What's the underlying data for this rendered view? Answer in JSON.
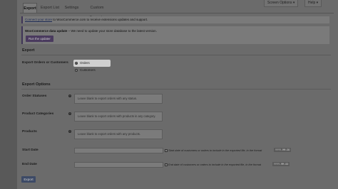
{
  "header": {
    "screen_options": "Screen Options ▾",
    "help": "Help ▾"
  },
  "tabs": [
    "Export",
    "Export List",
    "Settings",
    "Custom Formats"
  ],
  "notices": {
    "connect_link": "Connect your store",
    "connect_text": " to WooCommerce.com to receive extensions updates and support.",
    "update_bold": "WooCommerce data update",
    "update_text": " – We need to update your store database to the latest version.",
    "run_button": "Run the updater"
  },
  "export_section": {
    "title": "Export",
    "orders_or_customers_label": "Export Orders or Customers",
    "options": [
      "Orders",
      "Customers"
    ],
    "selected": "Orders"
  },
  "export_options": {
    "title": "Export Options",
    "order_statuses": {
      "label": "Order Statuses",
      "placeholder": "Leave blank to export orders with any status."
    },
    "product_categories": {
      "label": "Product Categories",
      "placeholder": "Leave blank to export orders with products in any category."
    },
    "products": {
      "label": "Products",
      "placeholder": "Leave blank to export orders with any products."
    },
    "start_date": {
      "label": "Start Date",
      "desc": "Start date of customers or orders to include in the exported file, in the format",
      "format": "YYYY-MM-DD"
    },
    "end_date": {
      "label": "End Date",
      "desc": "End date of customers or orders to include in the exported file, in the format",
      "format": "YYYY-MM-DD"
    }
  },
  "export_button": "Export",
  "colors": {
    "overlay_bg": "#6b6b6b",
    "button_primary": "#3d4a66",
    "notice_accent": "#3f3557"
  }
}
